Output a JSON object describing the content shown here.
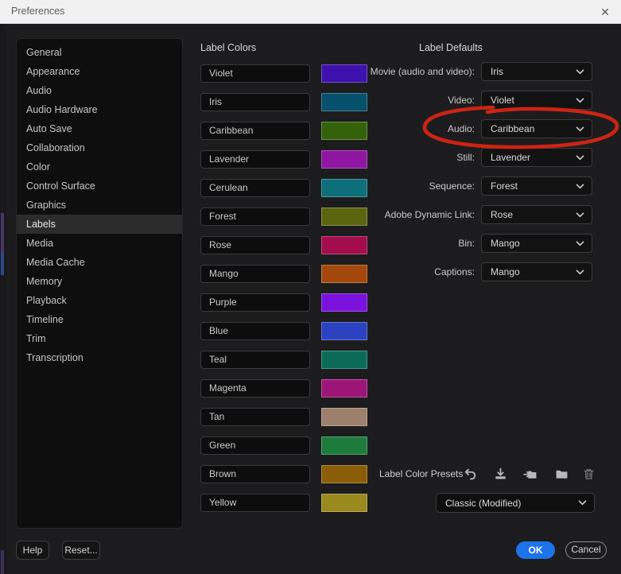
{
  "window": {
    "title": "Preferences",
    "close_icon": "✕"
  },
  "sidebar": {
    "selected": "Labels",
    "items": [
      {
        "label": "General"
      },
      {
        "label": "Appearance"
      },
      {
        "label": "Audio"
      },
      {
        "label": "Audio Hardware"
      },
      {
        "label": "Auto Save"
      },
      {
        "label": "Collaboration"
      },
      {
        "label": "Color"
      },
      {
        "label": "Control Surface"
      },
      {
        "label": "Graphics"
      },
      {
        "label": "Labels"
      },
      {
        "label": "Media"
      },
      {
        "label": "Media Cache"
      },
      {
        "label": "Memory"
      },
      {
        "label": "Playback"
      },
      {
        "label": "Timeline"
      },
      {
        "label": "Trim"
      },
      {
        "label": "Transcription"
      }
    ]
  },
  "label_colors": {
    "heading": "Label Colors",
    "rows": [
      {
        "name": "Violet",
        "color": "#3e11ae"
      },
      {
        "name": "Iris",
        "color": "#05506b"
      },
      {
        "name": "Caribbean",
        "color": "#34620a"
      },
      {
        "name": "Lavender",
        "color": "#8e16a0"
      },
      {
        "name": "Cerulean",
        "color": "#0c6f79"
      },
      {
        "name": "Forest",
        "color": "#5b640f"
      },
      {
        "name": "Rose",
        "color": "#a30c4d"
      },
      {
        "name": "Mango",
        "color": "#a4470b"
      },
      {
        "name": "Purple",
        "color": "#7a11dd"
      },
      {
        "name": "Blue",
        "color": "#2b43c0"
      },
      {
        "name": "Teal",
        "color": "#0b6b58"
      },
      {
        "name": "Magenta",
        "color": "#9d1677"
      },
      {
        "name": "Tan",
        "color": "#9d806c"
      },
      {
        "name": "Green",
        "color": "#1d7b3b"
      },
      {
        "name": "Brown",
        "color": "#8b5d08"
      },
      {
        "name": "Yellow",
        "color": "#9a8a1e"
      }
    ]
  },
  "label_defaults": {
    "heading": "Label Defaults",
    "rows": [
      {
        "label": "Movie (audio and video):",
        "value": "Iris"
      },
      {
        "label": "Video:",
        "value": "Violet"
      },
      {
        "label": "Audio:",
        "value": "Caribbean",
        "annotated": true
      },
      {
        "label": "Still:",
        "value": "Lavender"
      },
      {
        "label": "Sequence:",
        "value": "Forest"
      },
      {
        "label": "Adobe Dynamic Link:",
        "value": "Rose"
      },
      {
        "label": "Bin:",
        "value": "Mango"
      },
      {
        "label": "Captions:",
        "value": "Mango"
      }
    ]
  },
  "presets": {
    "label": "Label Color Presets",
    "icons": [
      {
        "name": "undo-icon"
      },
      {
        "name": "save-preset-icon"
      },
      {
        "name": "import-preset-icon"
      },
      {
        "name": "folder-icon"
      },
      {
        "name": "delete-icon",
        "dim": true
      }
    ],
    "dropdown_value": "Classic (Modified)"
  },
  "footer": {
    "help": "Help",
    "reset": "Reset...",
    "ok": "OK",
    "cancel": "Cancel"
  },
  "annotation": {
    "shape": "hand-drawn-ellipse",
    "around": "Audio default dropdown",
    "color": "#cc2413"
  },
  "colors": {
    "accent_blue": "#1d73e8",
    "titlebar_bg": "#f1f1f1",
    "dialog_bg": "#1c1c1e"
  }
}
